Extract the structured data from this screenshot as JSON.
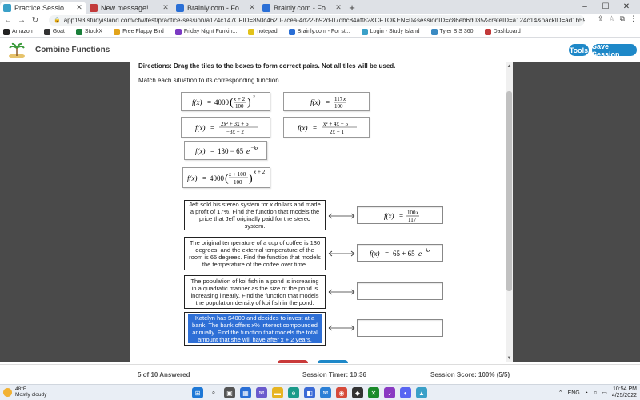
{
  "browser": {
    "tabs": [
      {
        "title": "Practice Session - Combine Func",
        "color": "#3aa0c8",
        "active": true
      },
      {
        "title": "New message!",
        "color": "#c23a3a",
        "active": false
      },
      {
        "title": "Brainly.com - For students. By st",
        "color": "#2a6fd6",
        "active": false
      },
      {
        "title": "Brainly.com - For students. By st",
        "color": "#2a6fd6",
        "active": false
      }
    ],
    "url": "app193.studyisland.com/cfw/test/practice-session/a124c147CFID=850c4620-7cea-4d22-b92d-07dbc84aff82&CFTOKEN=0&sessionID=c86eb6d035&crateID=a124c14&packID=ad1b59cc&qgCount=9b1c6&q...",
    "bookmarks": [
      {
        "label": "Amazon",
        "color": "#222"
      },
      {
        "label": "Goat",
        "color": "#333"
      },
      {
        "label": "StockX",
        "color": "#1a7f3a"
      },
      {
        "label": "Free Flappy Bird",
        "color": "#e2a31a"
      },
      {
        "label": "Friday Night Funkin...",
        "color": "#7b3ac2"
      },
      {
        "label": "notepad",
        "color": "#e2c21a"
      },
      {
        "label": "Brainly.com - For st...",
        "color": "#2a6fd6"
      },
      {
        "label": "Login - Study Island",
        "color": "#3aa0c8"
      },
      {
        "label": "Tyler SIS 360",
        "color": "#3a8ac2"
      },
      {
        "label": "Dashboard",
        "color": "#c23a3a"
      }
    ]
  },
  "app": {
    "title": "Combine Functions",
    "tools_label": "Tools",
    "save_label": "Save Session",
    "accent": "#1e88c8"
  },
  "question": {
    "directions": "Directions: Drag the tiles to the boxes to form correct pairs. Not all tiles will be used.",
    "instruction": "Match each situation to its corresponding function."
  },
  "tiles": [
    {
      "name": "tile-4000-power-x"
    },
    {
      "name": "tile-117x-over-100"
    },
    {
      "name": "tile-rational-quadratic"
    },
    {
      "name": "tile-x2-4x-5-over-2x-1"
    },
    {
      "name": "tile-130-minus-65e"
    },
    {
      "name": "tile-4000-power-x-plus-2"
    }
  ],
  "situations": [
    {
      "text": "Jeff sold his stereo system for x dollars and made a profit of 17%. Find the function that models the price that Jeff originally paid for the stereo system.",
      "answer": "f(x) = 100x/117"
    },
    {
      "text": "The original temperature of a cup of coffee is 130 degrees, and the external temperature of the room is 65 degrees. Find the function that models the temperature of the coffee over time.",
      "answer": "f(x) = 65 + 65e^(−kx)"
    },
    {
      "text": "The population of koi fish in a pond is increasing in a quadratic manner as the size of the pond is increasing linearly. Find the function that models the population density of koi fish in the pond.",
      "answer": ""
    },
    {
      "text": "Katelyn has $4000 and decides to invest at a bank. The bank offers x% interest compounded annually. Find the function that models the total amount that she will have after x + 2 years.",
      "answer": ""
    }
  ],
  "status": {
    "answered": "5 of 10 Answered",
    "timer": "Session Timer: 10:36",
    "score": "Session Score: 100% (5/5)"
  },
  "taskbar": {
    "temp": "48°F",
    "weather": "Mostly cloudy",
    "lang": "ENG",
    "time": "10:54 PM",
    "date": "4/25/2022"
  }
}
